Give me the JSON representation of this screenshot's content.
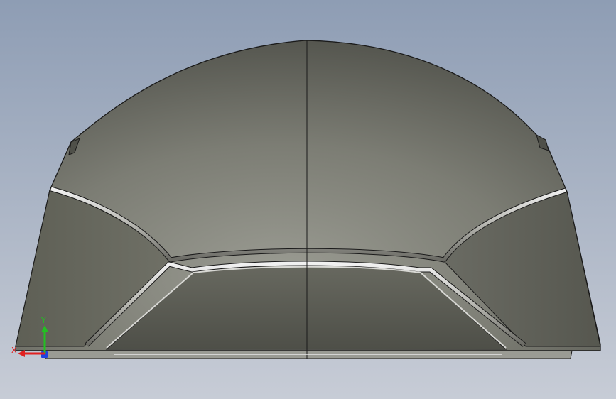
{
  "viewport": {
    "background_top_color": "#8e9db4",
    "background_bottom_color": "#c7ccd6",
    "model": {
      "body_color": "#6e6f66",
      "edge_color": "#1a1a1a",
      "highlight_color": "#e8e8e8"
    }
  },
  "triad": {
    "x_label": "X",
    "y_label": "Y",
    "x_color": "#e02020",
    "y_color": "#22c022",
    "z_color": "#2040e0"
  }
}
